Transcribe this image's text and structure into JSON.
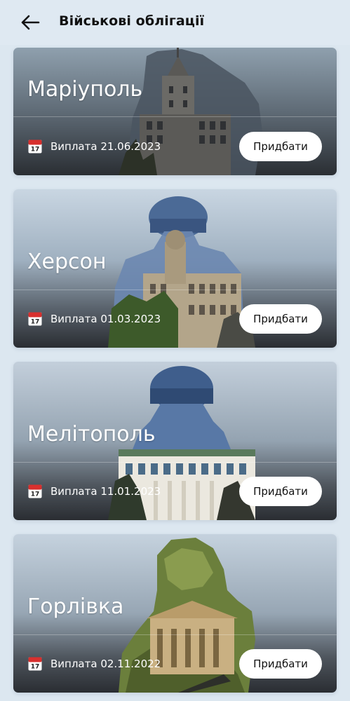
{
  "header": {
    "title": "Військові облігації",
    "back_icon": "arrow-left-icon"
  },
  "cards": [
    {
      "city": "Маріуполь",
      "payout": "Виплата 21.06.2023",
      "button": "Придбати",
      "calendar_month": "July",
      "calendar_day": "17"
    },
    {
      "city": "Херсон",
      "payout": "Виплата 01.03.2023",
      "button": "Придбати",
      "calendar_month": "July",
      "calendar_day": "17"
    },
    {
      "city": "Мелітополь",
      "payout": "Виплата 11.01.2023",
      "button": "Придбати",
      "calendar_month": "July",
      "calendar_day": "17"
    },
    {
      "city": "Горлівка",
      "payout": "Виплата 02.11.2022",
      "button": "Придбати",
      "calendar_month": "July",
      "calendar_day": "17"
    }
  ],
  "colors": {
    "page_background": "#dce7f0",
    "card_top": "#a9bccd",
    "card_bottom": "#2b2f35",
    "button_background": "#ffffff",
    "calendar_red": "#d8302e"
  }
}
